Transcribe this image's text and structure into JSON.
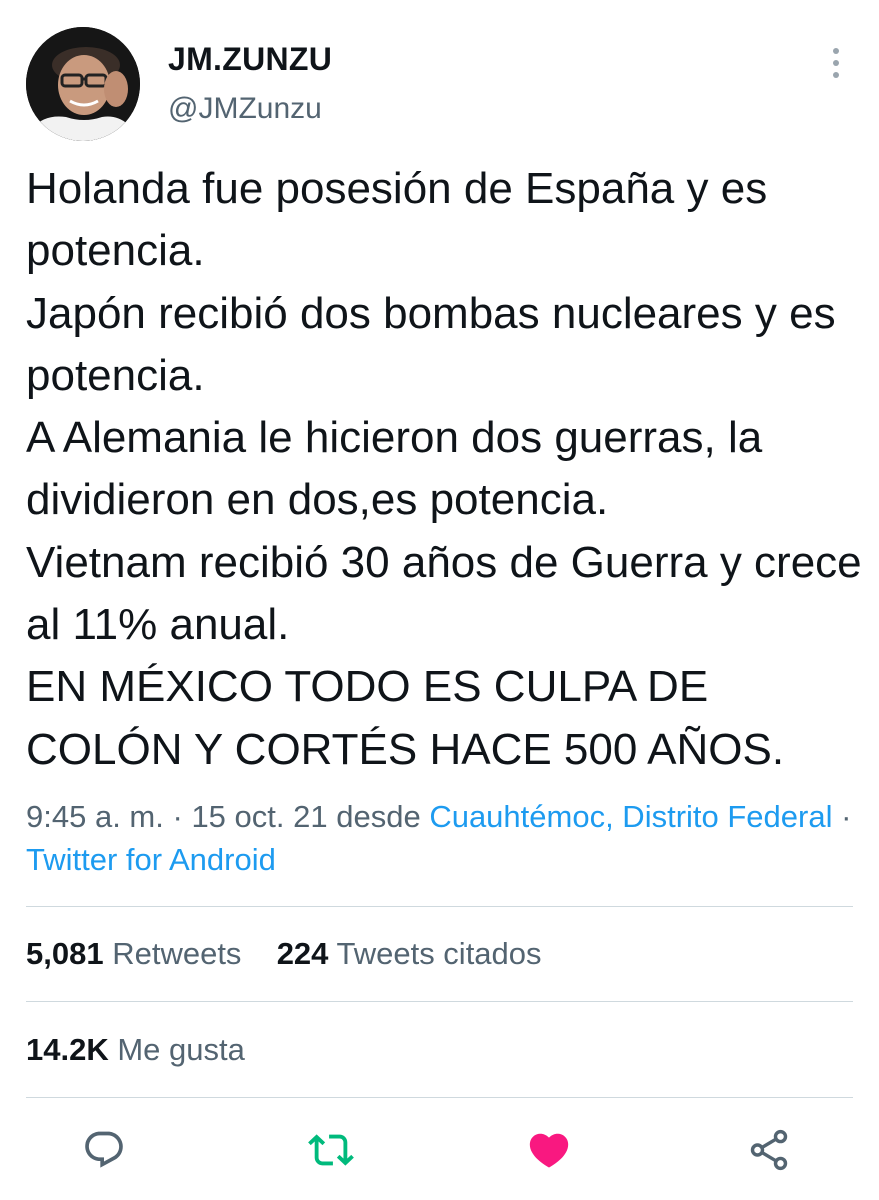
{
  "user": {
    "display_name": "JM.ZUNZU",
    "handle": "@JMZunzu"
  },
  "tweet": {
    "text": "Holanda fue posesión de España y es potencia.\nJapón recibió dos bombas nucleares y es potencia.\nA Alemania le hicieron dos guerras, la dividieron en dos,es potencia.\nVietnam recibió 30 años de Guerra y crece al 11% anual.\nEN MÉXICO TODO ES CULPA DE COLÓN Y CORTÉS HACE 500 AÑOS."
  },
  "meta": {
    "time": "9:45 a. m.",
    "separator": "·",
    "date": "15 oct. 21",
    "from_label": "desde",
    "location": "Cuauhtémoc, Distrito Federal",
    "client": "Twitter for Android"
  },
  "stats": {
    "retweets_count": "5,081",
    "retweets_label": "Retweets",
    "quotes_count": "224",
    "quotes_label": "Tweets citados",
    "likes_count": "14.2K",
    "likes_label": "Me gusta"
  },
  "icons": {
    "more": "more-vertical-icon",
    "reply": "reply-icon",
    "retweet": "retweet-icon",
    "like": "heart-icon",
    "share": "share-icon"
  },
  "colors": {
    "link": "#1d9bf0",
    "retweet_active": "#00ba7c",
    "like_active": "#f91880",
    "secondary_text": "#536471",
    "divider": "#cfd9de"
  }
}
